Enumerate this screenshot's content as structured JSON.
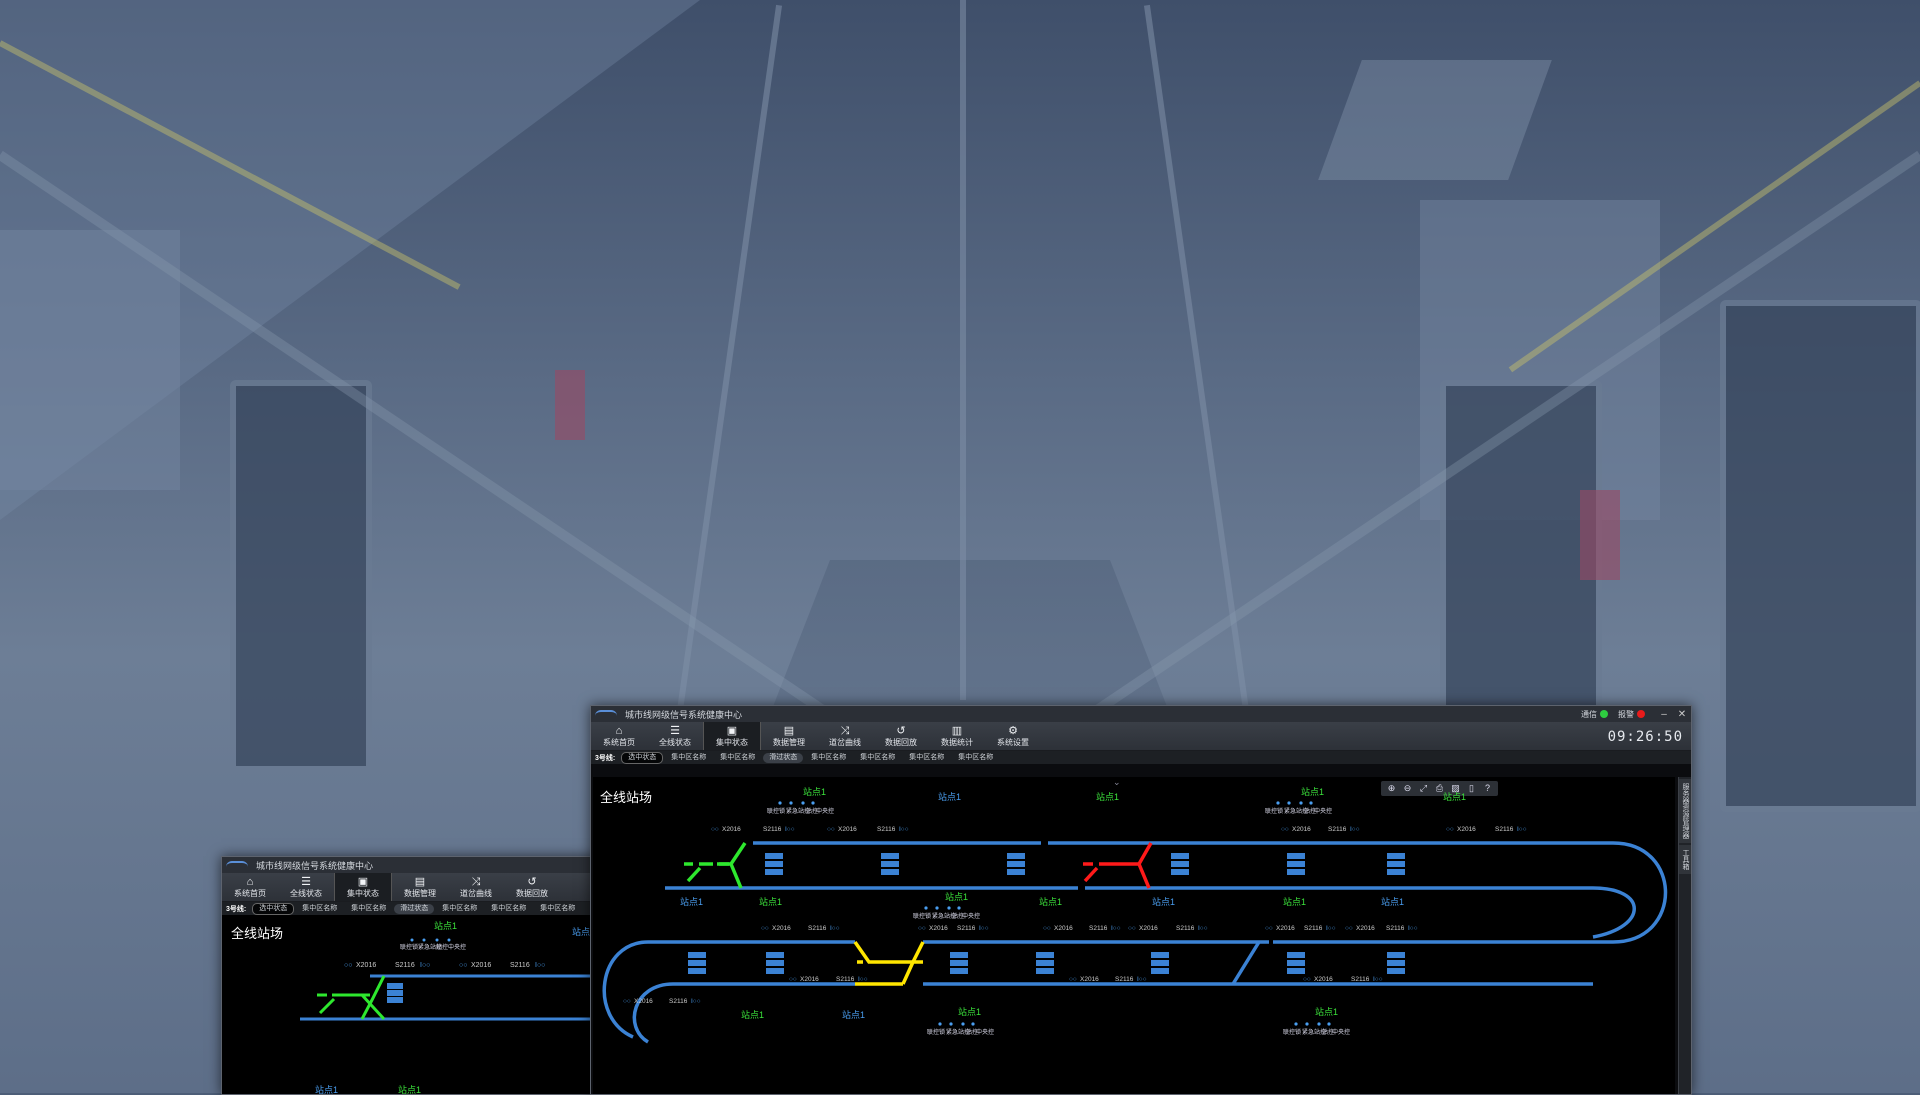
{
  "app": {
    "title": "城市线网级信号系统健康中心",
    "status_comm_label": "通信",
    "status_comm_color": "#2ecc40",
    "status_alarm_label": "报警",
    "status_alarm_color": "#e81b1b",
    "min_icon": "minimize-icon",
    "close_icon": "close-icon",
    "clock": "09:26:50"
  },
  "menu": [
    {
      "label": "系统首页",
      "icon": "home-icon",
      "glyph": "⌂"
    },
    {
      "label": "全线状态",
      "icon": "sliders-icon",
      "glyph": "☰"
    },
    {
      "label": "集中状态",
      "icon": "train-icon",
      "glyph": "▣"
    },
    {
      "label": "数据管理",
      "icon": "document-icon",
      "glyph": "▤"
    },
    {
      "label": "道岔曲线",
      "icon": "switch-curve-icon",
      "glyph": "⤨"
    },
    {
      "label": "数据回放",
      "icon": "replay-icon",
      "glyph": "↺"
    },
    {
      "label": "数据统计",
      "icon": "bar-chart-icon",
      "glyph": "▥"
    },
    {
      "label": "系统设置",
      "icon": "user-settings-icon",
      "glyph": "⚙"
    }
  ],
  "subtabs": {
    "line_label": "3号线:",
    "items": [
      "选中状态",
      "集中区名称",
      "集中区名称",
      "滑过状态",
      "集中区名称",
      "集中区名称",
      "集中区名称",
      "集中区名称"
    ]
  },
  "canvas": {
    "title": "全线站场",
    "station": "站点1",
    "legend_items": [
      "联控锁",
      "紧急站控",
      "站控",
      "中央控"
    ],
    "signal_a": "X2016",
    "signal_b": "S2116",
    "colors": {
      "track": "#3b82d4",
      "ok": "#2ee82e",
      "warn": "#ffe600",
      "fault": "#ff1a1a",
      "station_green": "#3be33b",
      "station_blue": "#4a9ef0"
    }
  },
  "toolbar": [
    "zoom-in-icon",
    "zoom-out-icon",
    "fit-icon",
    "print-icon",
    "image-icon",
    "pdf-icon",
    "help-icon"
  ],
  "side_tabs": [
    "服务器资源管理器",
    "工具箱"
  ]
}
